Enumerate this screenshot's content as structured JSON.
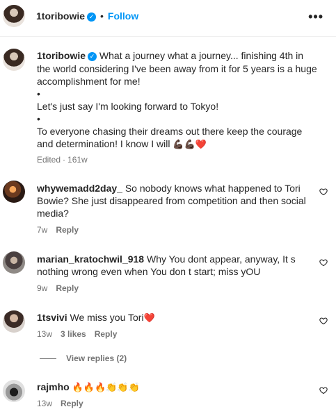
{
  "header": {
    "username": "1toribowie",
    "separator": "•",
    "follow_label": "Follow",
    "more_label": "•••"
  },
  "caption": {
    "username": "1toribowie",
    "line1": "What a journey what a journey... finishing 4th in",
    "line2": "the world considering I've been away from it for 5 years is a huge",
    "line3": "accomplishment for me!",
    "bullet1": "•",
    "line4": "Let's just say I'm looking forward to Tokyo!",
    "bullet2": "•",
    "line5": "To everyone chasing their dreams out there keep the courage",
    "line6": "and determination! I know I will",
    "emojis": "💪🏿💪🏿❤️",
    "edited": "Edited",
    "dot": "·",
    "time": "161w"
  },
  "comments": [
    {
      "username": "whywemadd2day_",
      "line1": "So nobody knows what happened to Tori",
      "line2": "Bowie? She just disappeared from competition and then social",
      "line3": "media?",
      "time": "7w",
      "reply": "Reply"
    },
    {
      "username": "marian_kratochwil_918",
      "line1": "Why You dont appear, anyway, It s",
      "line2": "nothing wrong even when You don t start; miss yOU",
      "time": "9w",
      "reply": "Reply"
    },
    {
      "username": "1tsvivi",
      "line1": "We miss you Tori",
      "emoji": "❤️",
      "time": "13w",
      "likes": "3 likes",
      "reply": "Reply",
      "view_replies": "View replies (2)"
    },
    {
      "username": "rajmho",
      "emoji": "🔥🔥🔥👏👏👏",
      "time": "13w",
      "reply": "Reply"
    }
  ],
  "colors": {
    "accent": "#0095f6",
    "secondary_text": "#737373",
    "heart_red": "#ed1c40"
  },
  "icons": [
    "verified-badge-icon",
    "more-options-icon",
    "heart-outline-icon"
  ]
}
